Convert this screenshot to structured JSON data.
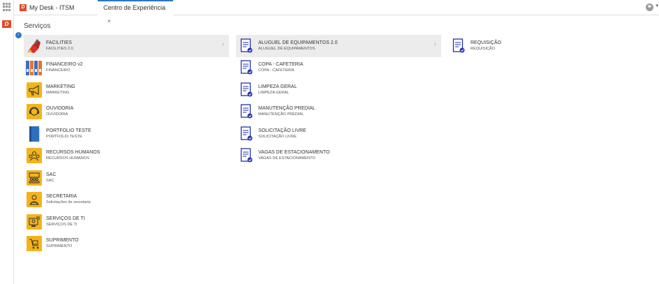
{
  "tabs": [
    {
      "label": "My Desk - ITSM"
    },
    {
      "label": "Centro de Experiência",
      "close": "×"
    }
  ],
  "brand_logo_letter": "D",
  "page": {
    "heading": "Serviços"
  },
  "colors": {
    "accent": "#2b78c5",
    "brand": "#e04b2a",
    "icon_yellow": "#f3b41b",
    "doc_blue": "#2233aa"
  },
  "column1": [
    {
      "title": "FACILITIES",
      "subtitle": "FACILITIES 2.0",
      "icon": "facilities-paint-icon",
      "active": true
    },
    {
      "title": "FINANCEIRO v2",
      "subtitle": "FINANCEIRO",
      "icon": "binders-icon"
    },
    {
      "title": "MARKETING",
      "subtitle": "MARKETING",
      "icon": "megaphone-icon"
    },
    {
      "title": "OUVIDORIA",
      "subtitle": "OUVIDORIA",
      "icon": "headset-icon"
    },
    {
      "title": "PORTFOLIO TESTE",
      "subtitle": "PORTFOLIO TESTE",
      "icon": "book-icon"
    },
    {
      "title": "RECURSOS HUMANOS",
      "subtitle": "RECURSOS HUMANOS",
      "icon": "people-icon"
    },
    {
      "title": "SAC",
      "subtitle": "SAC",
      "icon": "customer-service-icon"
    },
    {
      "title": "SECRETARIA",
      "subtitle": "Solicitações de secretaria",
      "icon": "secretary-icon"
    },
    {
      "title": "SERVIÇOS DE TI",
      "subtitle": "SERVIÇOS DE TI",
      "icon": "it-support-icon"
    },
    {
      "title": "SUPRIMENTO",
      "subtitle": "SUPRIMENTO",
      "icon": "supply-cart-icon"
    }
  ],
  "column2": [
    {
      "title": "ALUGUEL DE EQUIPAMENTOS 2.0",
      "subtitle": "ALUGUEL DE EQUIPAMENTOS",
      "icon": "request-document-icon",
      "active": true
    },
    {
      "title": "COPA - CAFETERIA",
      "subtitle": "COPA - CAFETERIA",
      "icon": "request-document-icon"
    },
    {
      "title": "LIMPEZA GERAL",
      "subtitle": "LIMPEZA GERAL",
      "icon": "request-document-icon"
    },
    {
      "title": "MANUTENÇÃO PREDIAL",
      "subtitle": "MANUTENÇÃO PREDIAL",
      "icon": "request-document-icon"
    },
    {
      "title": "SOLICITAÇÃO LIVRE",
      "subtitle": "SOLICITAÇÃO LIVRE",
      "icon": "request-document-icon"
    },
    {
      "title": "VAGAS DE ESTACIONAMENTO",
      "subtitle": "VAGAS DE ESTACIONAMENTO",
      "icon": "request-document-icon"
    }
  ],
  "column3": [
    {
      "title": "REQUISIÇÃO",
      "subtitle": "REQUISIÇÃO",
      "icon": "request-document-icon"
    }
  ]
}
